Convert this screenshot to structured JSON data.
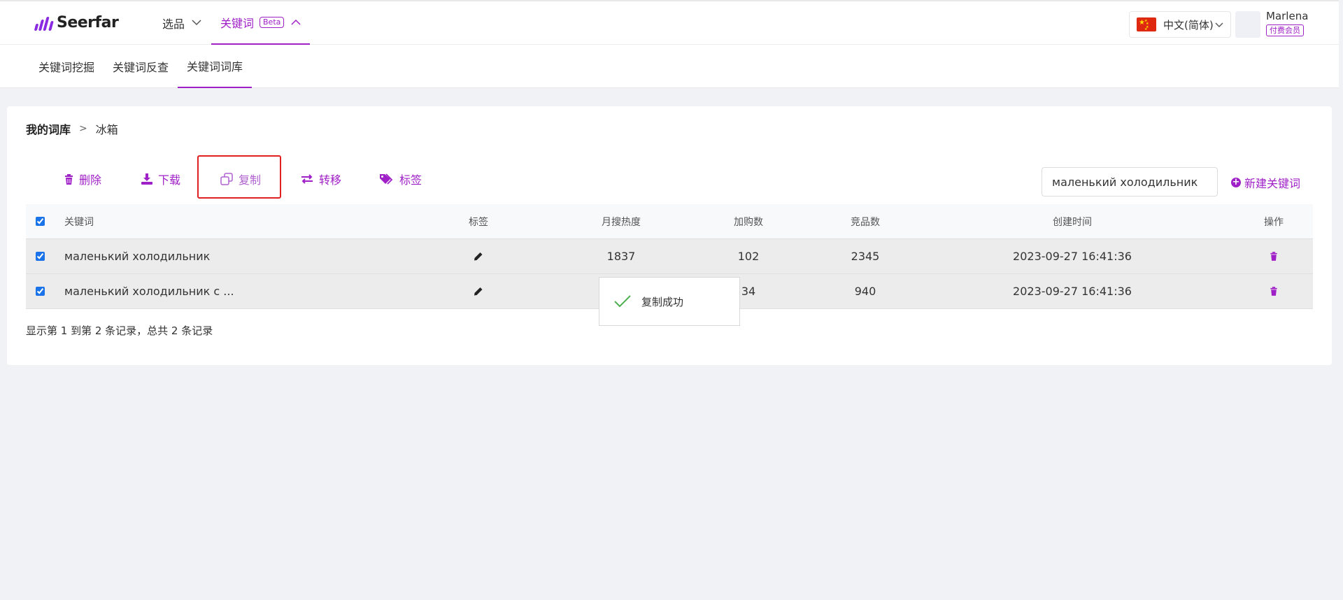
{
  "header": {
    "brand": "Seerfar",
    "nav": [
      {
        "label": "选品"
      },
      {
        "label": "关键词",
        "badge": "Beta"
      }
    ],
    "language": "中文(简体)",
    "user": {
      "name": "Marlena",
      "membership": "付费会员"
    }
  },
  "subnav": {
    "items": [
      {
        "label": "关键词挖掘"
      },
      {
        "label": "关键词反查"
      },
      {
        "label": "关键词词库"
      }
    ],
    "active": "关键词词库"
  },
  "breadcrumb": {
    "root": "我的词库",
    "separator": ">",
    "current": "冰箱"
  },
  "toolbar": {
    "delete": "删除",
    "download": "下载",
    "copy": "复制",
    "transfer": "转移",
    "tag": "标签",
    "search_value": "маленький холодильник",
    "new_keyword": "新建关键词"
  },
  "table": {
    "headers": {
      "keyword": "关键词",
      "tag": "标签",
      "monthly_heat": "月搜热度",
      "cart_adds": "加购数",
      "competitors": "竞品数",
      "created": "创建时间",
      "actions": "操作"
    },
    "rows": [
      {
        "keyword": "маленький холодильник",
        "monthly_heat": "1837",
        "cart_adds": "102",
        "competitors": "2345",
        "created": "2023-09-27 16:41:36"
      },
      {
        "keyword": "маленький холодильник с ...",
        "monthly_heat": "",
        "cart_adds": "34",
        "competitors": "940",
        "created": "2023-09-27 16:41:36"
      }
    ]
  },
  "footer_text": "显示第 1 到第 2 条记录，总共 2 条记录",
  "toast": {
    "message": "复制成功"
  },
  "colors": {
    "accent": "#a020c8",
    "highlight_border": "#e02020",
    "success": "#4caf50"
  }
}
